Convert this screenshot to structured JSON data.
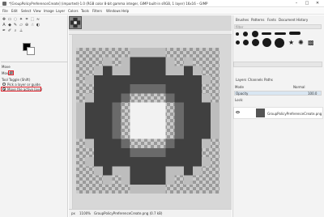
{
  "window": {
    "title": "*[GroupPolicyPreferenceCreate] (imported)-1.0 (RGB color 8-bit gamma integer, GIMP built-in sRGB, 1 layer) 16x16 – GIMP",
    "controls": [
      "–",
      "□",
      "✕"
    ]
  },
  "menubar": [
    "File",
    "Edit",
    "Select",
    "View",
    "Image",
    "Layer",
    "Colors",
    "Tools",
    "Filters",
    "Windows",
    "Help"
  ],
  "tool_options": {
    "title": "Move",
    "move_label": "Move:",
    "tool_toggle_label": "Tool Toggle (Shift)",
    "option_pick": "Pick a layer or guide",
    "option_active": "Move the active layer"
  },
  "right_panel": {
    "tabs_top": [
      "Brushes",
      "Patterns",
      "Fonts",
      "Document History"
    ],
    "filter_placeholder": "filter",
    "layers_tabs": [
      "Layers",
      "Channels",
      "Paths"
    ],
    "mode_label": "Mode",
    "mode_value": "Normal",
    "opacity_label": "Opacity",
    "opacity_value": "100.0",
    "lock_label": "Lock:",
    "layer_name": "GroupPolicyPreferenceCreate.png"
  },
  "status": {
    "unit": "px",
    "zoom": "1100%",
    "filename": "GroupPolicyPreferenceCreate.png (0.7 kB)"
  },
  "colors": {
    "gear_dark": "#404040",
    "gear_mid": "#6a6a6a",
    "gear_light": "#bdbdbd",
    "gear_white": "#f2f2f2",
    "annotation_red": "#e0202a"
  }
}
